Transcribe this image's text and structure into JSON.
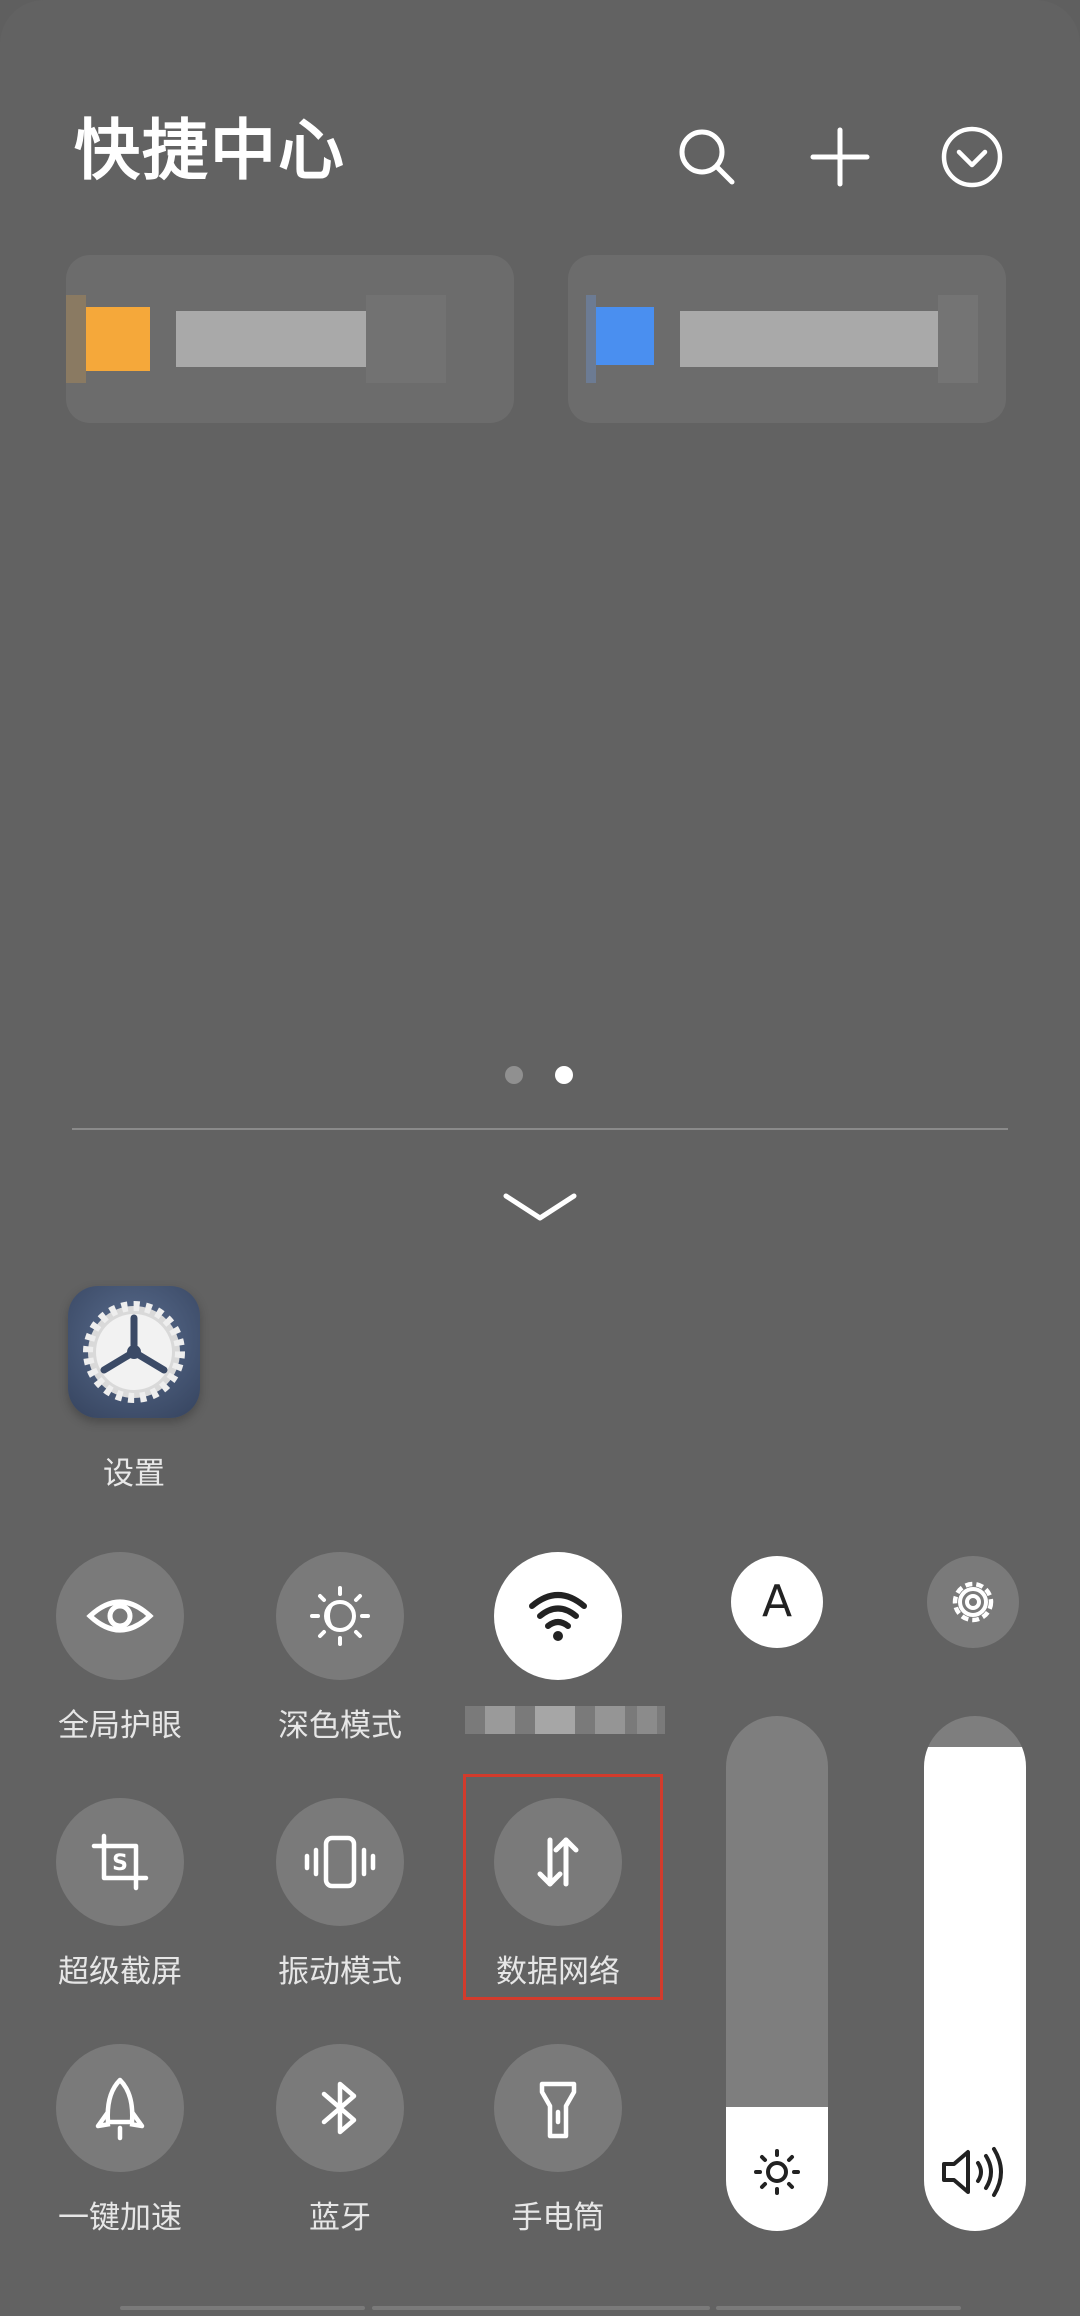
{
  "header": {
    "title": "快捷中心",
    "buttons": [
      "search-icon",
      "plus-icon",
      "collapse-icon"
    ]
  },
  "pager": {
    "count": 2,
    "active_index": 1
  },
  "apps": [
    {
      "label": "设置",
      "icon": "settings-app-icon"
    }
  ],
  "tiles": [
    {
      "label": "全局护眼",
      "icon": "eye-icon",
      "active": false
    },
    {
      "label": "深色模式",
      "icon": "dark-mode-icon",
      "active": false
    },
    {
      "label": "",
      "icon": "wifi-icon",
      "active": true
    },
    {
      "label": "超级截屏",
      "icon": "screenshot-icon",
      "active": false
    },
    {
      "label": "振动模式",
      "icon": "vibrate-icon",
      "active": false
    },
    {
      "label": "数据网络",
      "icon": "mobile-data-icon",
      "active": false,
      "highlighted": true
    },
    {
      "label": "一键加速",
      "icon": "rocket-icon",
      "active": false
    },
    {
      "label": "蓝牙",
      "icon": "bluetooth-icon",
      "active": false
    },
    {
      "label": "手电筒",
      "icon": "flashlight-icon",
      "active": false
    }
  ],
  "sliders": {
    "brightness": {
      "auto_label": "A",
      "level": 0.24,
      "icon": "sun-icon"
    },
    "volume": {
      "level": 0.94,
      "icon": "volume-icon",
      "settings_icon": "gear-icon"
    }
  },
  "colors": {
    "panel": "#626262",
    "tile": "#7a7a7a",
    "highlight": "#d33b2c",
    "card_orange": "#f5a83a",
    "card_blue": "#4a8ff0"
  }
}
